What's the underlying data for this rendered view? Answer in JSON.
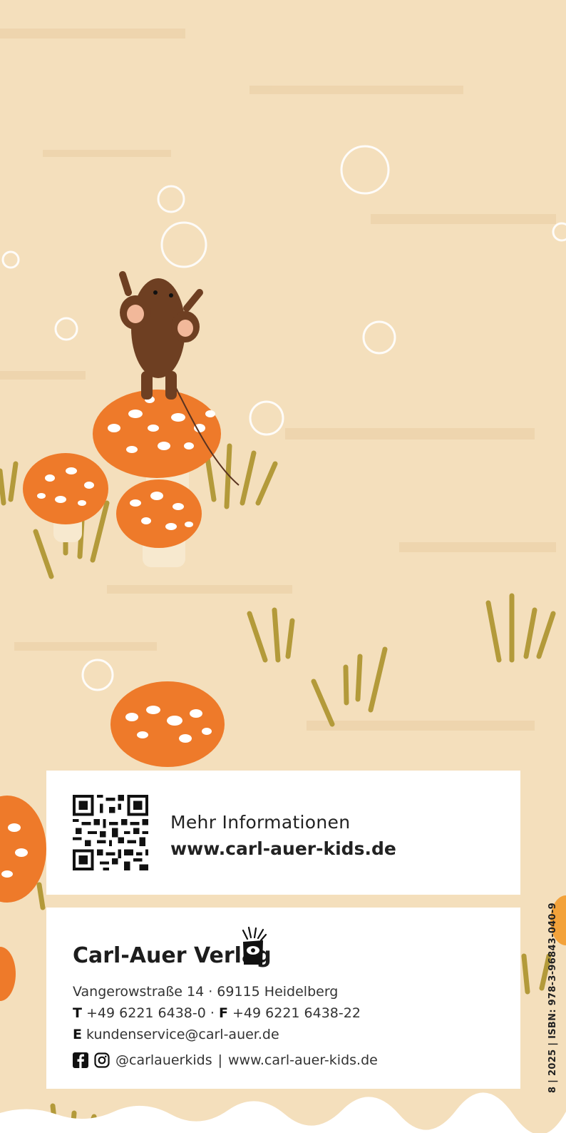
{
  "info_card": {
    "label": "Mehr Informationen",
    "url": "www.carl-auer-kids.de"
  },
  "publisher": {
    "name": "Carl-Auer Verlag",
    "address": "Vangerowstraße 14 · 69115 Heidelberg",
    "phone_prefix": "T",
    "phone": "+49 6221 6438-0",
    "separator": " · ",
    "fax_prefix": "F",
    "fax": "+49 6221 6438-22",
    "email_prefix": "E",
    "email": "kundenservice@carl-auer.de",
    "social_handle": "@carlauerkids",
    "social_divider": "|",
    "website": "www.carl-auer-kids.de"
  },
  "spine_text": "8 | 2025 | ISBN: 978-3-96843-040-9",
  "icons": [
    "qr-code-icon",
    "carl-auer-logo-icon",
    "facebook-icon",
    "instagram-icon"
  ],
  "colors": {
    "background": "#f4dfbc",
    "mushroom": "#ee7a2a",
    "grass": "#b39a3a",
    "mouse": "#6e3f22",
    "card": "#ffffff"
  }
}
